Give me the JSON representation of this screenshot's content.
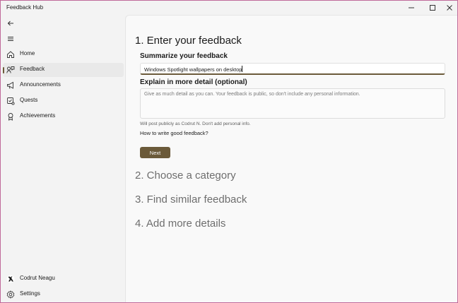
{
  "window": {
    "title": "Feedback Hub"
  },
  "sidebar": {
    "items": [
      {
        "label": "Home",
        "icon": "home-icon"
      },
      {
        "label": "Feedback",
        "icon": "feedback-icon",
        "selected": true
      },
      {
        "label": "Announcements",
        "icon": "megaphone-icon"
      },
      {
        "label": "Quests",
        "icon": "quests-icon"
      },
      {
        "label": "Achievements",
        "icon": "medal-icon"
      }
    ],
    "footer": [
      {
        "label": "Codrut Neagu",
        "icon": "user-avatar-icon"
      },
      {
        "label": "Settings",
        "icon": "gear-icon"
      }
    ]
  },
  "main": {
    "step1": {
      "heading": "1. Enter your feedback"
    },
    "summary": {
      "label": "Summarize your feedback",
      "value": "Windows Spotlight wallpapers on desktop"
    },
    "detail": {
      "label": "Explain in more detail (optional)",
      "placeholder": "Give as much detail as you can. Your feedback is public, so don't include any personal information."
    },
    "post_note": "Will post publicly as Codrut N. Don't add personal info.",
    "howto_link": "How to write good feedback?",
    "next_label": "Next",
    "step2": {
      "heading": "2. Choose a category"
    },
    "step3": {
      "heading": "3. Find similar feedback"
    },
    "step4": {
      "heading": "4. Add more details"
    }
  },
  "colors": {
    "accent": "#6b5a3a",
    "window_border": "#c06a9a"
  }
}
